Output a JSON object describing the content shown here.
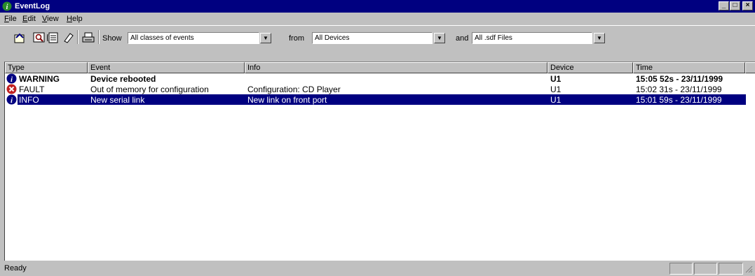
{
  "window": {
    "title": "EventLog",
    "controls": {
      "minimize": "_",
      "maximize": "□",
      "close": "×"
    }
  },
  "menu": [
    {
      "mnemonic": "F",
      "rest": "ile"
    },
    {
      "mnemonic": "E",
      "rest": "dit"
    },
    {
      "mnemonic": "V",
      "rest": "iew"
    },
    {
      "mnemonic": "H",
      "rest": "elp"
    }
  ],
  "toolbar": {
    "icons": [
      "open-icon",
      "find-icon",
      "clear-icon",
      "erase-icon",
      "print-icon"
    ],
    "show_label": "Show",
    "class_filter": "All classes of events",
    "from_label": "from",
    "device_filter": "All Devices",
    "and_label": "and",
    "file_filter": "All .sdf Files",
    "dropdown_glyph": "▼"
  },
  "columns": [
    "Type",
    "Event",
    "Info",
    "Device",
    "Time"
  ],
  "rows": [
    {
      "type": "WARNING",
      "event": "Device rebooted",
      "info": "",
      "device": "U1",
      "time": "15:05 52s - 23/11/1999",
      "icon": "info-icon",
      "bold": true,
      "selected": false
    },
    {
      "type": "FAULT",
      "event": "Out of memory for configuration",
      "info": "Configuration: CD Player",
      "device": "U1",
      "time": "15:02 31s - 23/11/1999",
      "icon": "fault-icon",
      "bold": false,
      "selected": false
    },
    {
      "type": "INFO",
      "event": "New serial link",
      "info": "New link on front port",
      "device": "U1",
      "time": "15:01 59s - 23/11/1999",
      "icon": "info-icon",
      "bold": false,
      "selected": true
    }
  ],
  "status": {
    "text": "Ready"
  },
  "colors": {
    "titlebar": "#000080",
    "selection": "#000080",
    "face": "#c0c0c0",
    "info_icon": "#000080",
    "fault_icon": "#c02020"
  }
}
